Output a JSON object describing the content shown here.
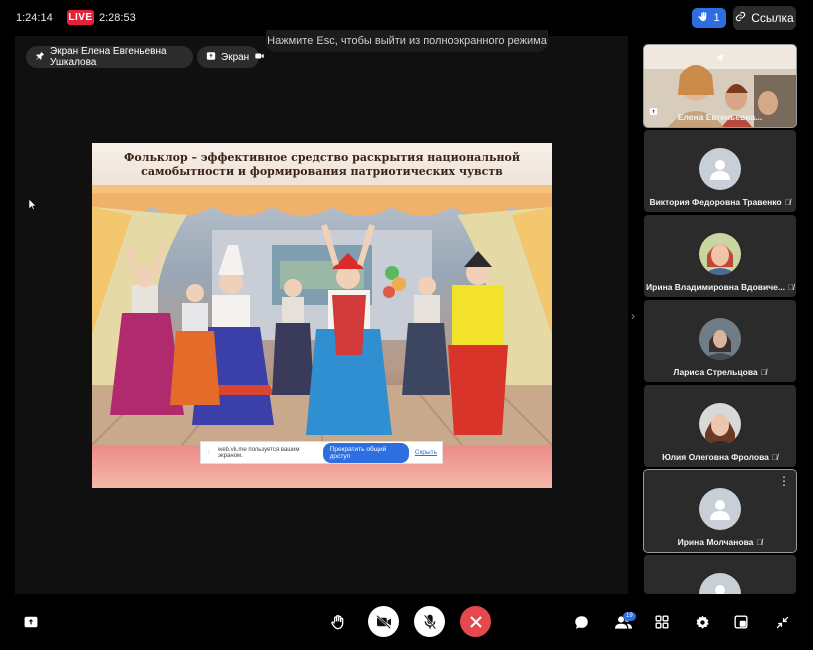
{
  "topbar": {
    "clock": "1:24:14",
    "live_label": "LIVE",
    "duration": "2:28:53",
    "hands_count": "1",
    "link_label": "Ссылка",
    "esc_hint": "Нажмите Esc, чтобы выйти из полноэкранного режима"
  },
  "stage": {
    "pinned_label": "Экран Елена Евгеньевна Ушкалова",
    "screen_label": "Экран",
    "slide_title_1": "Фольклор – эффективное средство раскрытия национальной",
    "slide_title_2": "самобытности и формирования патриотических чувств",
    "share_notice": "web.vk.me пользуется вашим экраном.",
    "share_stop": "Прекратить общий доступ",
    "share_hide": "Скрыть"
  },
  "participants": [
    {
      "name": "Елена Евгеньевна...",
      "type": "video",
      "muted": false
    },
    {
      "name": "Виктория Федоровна Травенко",
      "type": "placeholder",
      "muted": true
    },
    {
      "name": "Ирина Владимировна Вдовиче...",
      "type": "photo",
      "muted": true
    },
    {
      "name": "Лариса Стрельцова",
      "type": "photo",
      "muted": true
    },
    {
      "name": "Юлия Олеговна Фролова",
      "type": "photo",
      "muted": true
    },
    {
      "name": "Ирина Молчанова",
      "type": "placeholder",
      "muted": true
    }
  ],
  "toolbar": {
    "participants_badge": "19"
  },
  "colors": {
    "accent": "#2d6fe0",
    "live": "#e4223a",
    "end_call": "#e5484d",
    "tile_bg": "#2b2b2b"
  }
}
